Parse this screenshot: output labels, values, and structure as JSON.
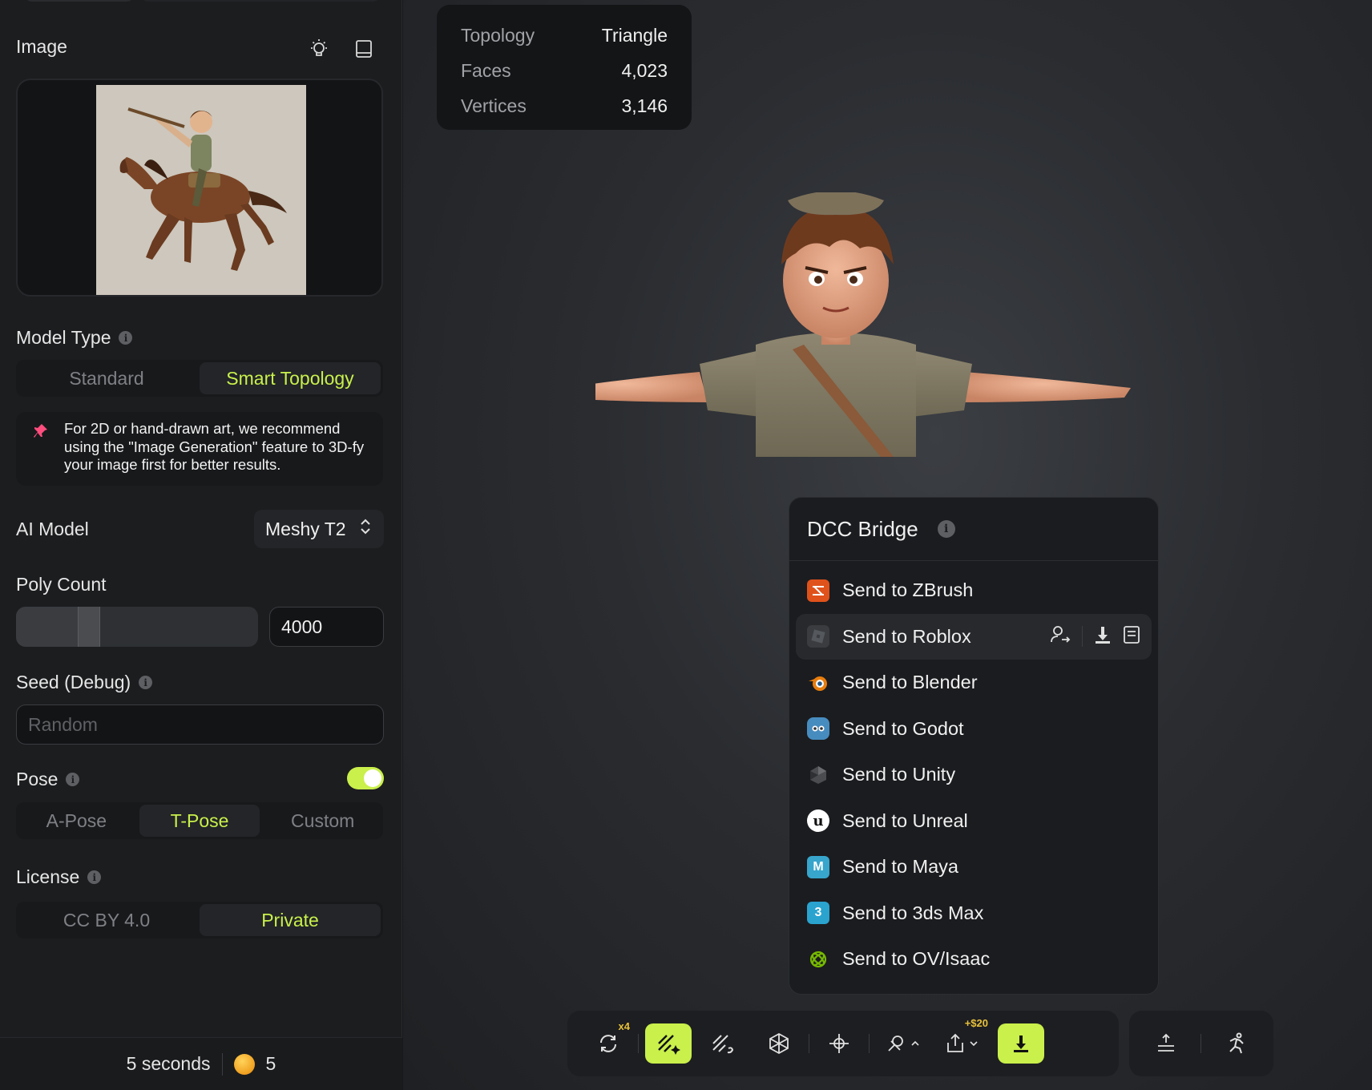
{
  "sidebar": {
    "image": {
      "title": "Image"
    },
    "model_type": {
      "title": "Model Type",
      "options": [
        "Standard",
        "Smart Topology"
      ],
      "selected": 1
    },
    "tip": {
      "text": "For 2D or hand-drawn art, we recommend using the \"Image Generation\" feature to 3D-fy your image first for better results."
    },
    "ai_model": {
      "title": "AI Model",
      "value": "Meshy T2"
    },
    "poly_count": {
      "title": "Poly Count",
      "value": "4000",
      "slider_fraction": 0.3
    },
    "seed": {
      "title": "Seed (Debug)",
      "placeholder": "Random"
    },
    "pose": {
      "title": "Pose",
      "enabled": true,
      "options": [
        "A-Pose",
        "T-Pose",
        "Custom"
      ],
      "selected": 1
    },
    "license": {
      "title": "License",
      "options": [
        "CC BY 4.0",
        "Private"
      ],
      "selected": 1
    },
    "footer": {
      "time": "5 seconds",
      "credits": "5"
    }
  },
  "stats": [
    {
      "key": "Topology",
      "value": "Triangle"
    },
    {
      "key": "Faces",
      "value": "4,023"
    },
    {
      "key": "Vertices",
      "value": "3,146"
    }
  ],
  "dcc": {
    "title": "DCC Bridge",
    "items": [
      {
        "label": "Send to ZBrush",
        "icon": "zbrush-icon",
        "color": "#e0521b"
      },
      {
        "label": "Send to Roblox",
        "icon": "roblox-icon",
        "color": "#3a3c40"
      },
      {
        "label": "Send to Blender",
        "icon": "blender-icon",
        "color": "#e87d0d"
      },
      {
        "label": "Send to Godot",
        "icon": "godot-icon",
        "color": "#478cbf"
      },
      {
        "label": "Send to Unity",
        "icon": "unity-icon",
        "color": "#555"
      },
      {
        "label": "Send to Unreal",
        "icon": "unreal-icon",
        "color": "#ffffff"
      },
      {
        "label": "Send to Maya",
        "icon": "maya-icon",
        "color": "#37a5cc"
      },
      {
        "label": "Send to 3ds Max",
        "icon": "3dsmax-icon",
        "color": "#2aa3cf"
      },
      {
        "label": "Send to OV/Isaac",
        "icon": "omniverse-icon",
        "color": "#76b900"
      }
    ],
    "maya_glyph": "M",
    "max_glyph": "3"
  },
  "toolbar": {
    "retry_badge": "x4",
    "export_badge": "+$20"
  },
  "colors": {
    "accent": "#c9f04b",
    "panel": "#1c1d1f"
  }
}
